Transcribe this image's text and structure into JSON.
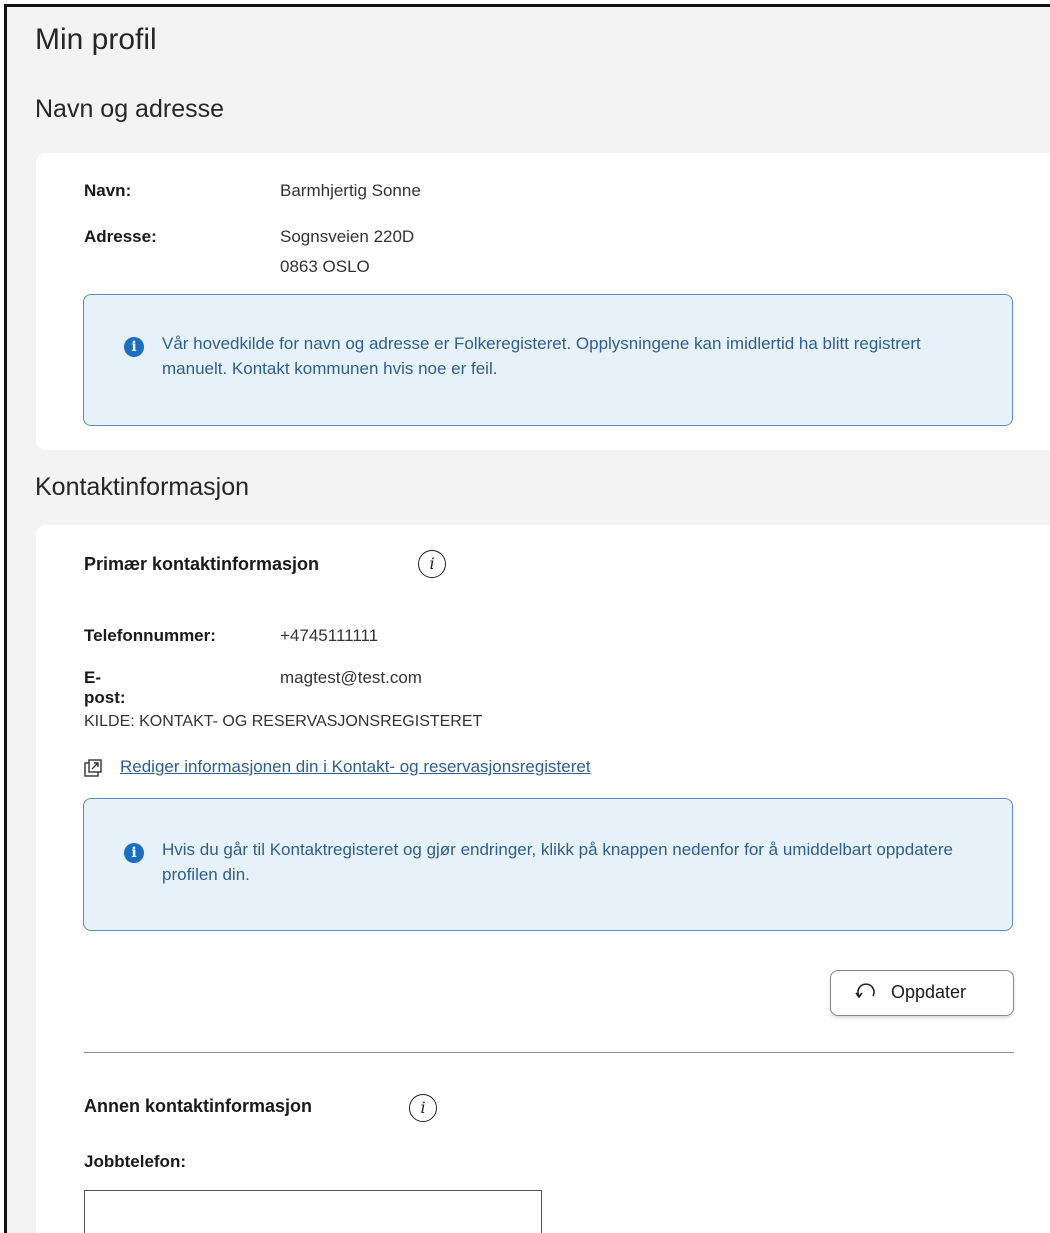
{
  "page": {
    "title": "Min profil"
  },
  "name_address": {
    "heading": "Navn og adresse",
    "name_label": "Navn:",
    "name_value": "Barmhjertig Sonne",
    "address_label": "Adresse:",
    "address_line1": "Sognsveien 220D",
    "address_line2": "0863 OSLO",
    "info_icon": "info-icon",
    "info_text": "Vår hovedkilde for navn og adresse er Folkeregisteret. Opplysningene kan imidlertid ha blitt registrert manuelt. Kontakt kommunen hvis noe er feil."
  },
  "contact": {
    "heading": "Kontaktinformasjon",
    "primary_heading": "Primær kontaktinformasjon",
    "help_icon": "help-icon",
    "phone_label": "Telefonnummer:",
    "phone_value": "+4745111111",
    "email_label": "E-post:",
    "email_value": "magtest@test.com",
    "source": "KILDE: KONTAKT- OG RESERVASJONSREGISTERET",
    "edit_link_icon": "external-link-icon",
    "edit_link": "Rediger informasjonen din i Kontakt- og reservasjonsregisteret",
    "info_text": "Hvis du går til Kontaktregisteret og gjør endringer, klikk på knappen nedenfor for å umiddelbart oppdatere profilen din.",
    "refresh_icon": "refresh-icon",
    "refresh_button": "Oppdater",
    "other_heading": "Annen kontaktinformasjon",
    "work_phone_label": "Jobbtelefon:",
    "work_phone_value": ""
  },
  "colors": {
    "page_bg": "#f3f3f3",
    "card_bg": "#ffffff",
    "info_bg": "#e7f1f9",
    "info_border": "#5d8fbf",
    "info_icon": "#1b6ec2",
    "link": "#2f5e92"
  }
}
